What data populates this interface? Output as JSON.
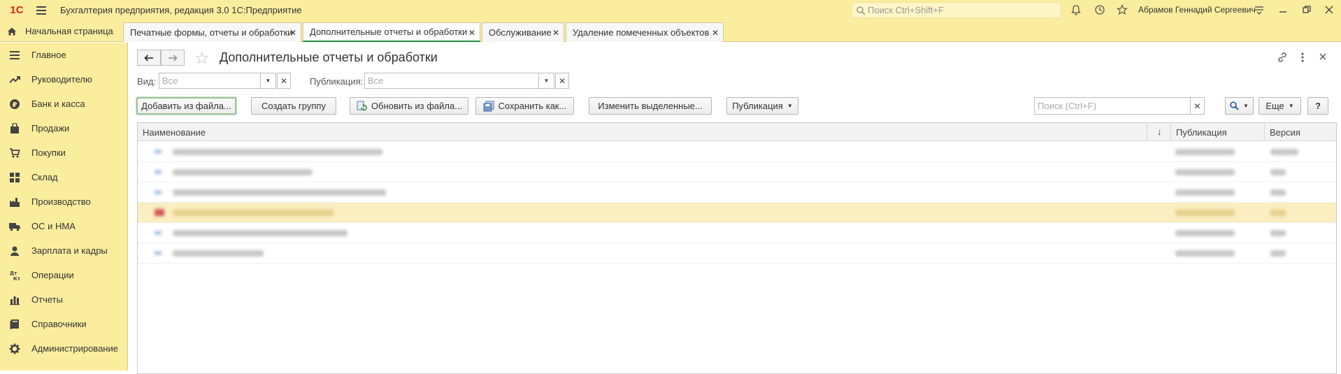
{
  "titlebar": {
    "logo_text": "1С",
    "app_title": "Бухгалтерия предприятия, редакция 3.0 1С:Предприятие",
    "search_placeholder": "Поиск Ctrl+Shift+F",
    "user_name": "Абрамов Геннадий Сергеевич",
    "accent_color": "#fbed9e"
  },
  "tabs": {
    "home_label": "Начальная страница",
    "items": [
      {
        "label": "Печатные формы, отчеты и обработки"
      },
      {
        "label": "Дополнительные отчеты и обработки",
        "active": true
      },
      {
        "label": "Обслуживание"
      },
      {
        "label": "Удаление помеченных объектов"
      }
    ]
  },
  "sidebar": {
    "items": [
      {
        "label": "Главное",
        "icon": "menu-lines-icon"
      },
      {
        "label": "Руководителю",
        "icon": "trend-icon"
      },
      {
        "label": "Банк и касса",
        "icon": "ruble-coin-icon"
      },
      {
        "label": "Продажи",
        "icon": "shopping-bag-icon"
      },
      {
        "label": "Покупки",
        "icon": "cart-icon"
      },
      {
        "label": "Склад",
        "icon": "warehouse-grid-icon"
      },
      {
        "label": "Производство",
        "icon": "factory-icon"
      },
      {
        "label": "ОС и НМА",
        "icon": "truck-icon"
      },
      {
        "label": "Зарплата и кадры",
        "icon": "person-icon"
      },
      {
        "label": "Операции",
        "icon": "dt-kt-icon"
      },
      {
        "label": "Отчеты",
        "icon": "bar-chart-icon"
      },
      {
        "label": "Справочники",
        "icon": "book-icon"
      },
      {
        "label": "Администрирование",
        "icon": "gear-icon"
      }
    ]
  },
  "form": {
    "title": "Дополнительные отчеты и обработки",
    "filters": {
      "vid_label": "Вид:",
      "vid_value": "Все",
      "publication_label": "Публикация:",
      "publication_value": "Все"
    },
    "toolbar": {
      "add_from_file": "Добавить из файла...",
      "create_group": "Создать группу",
      "update_from_file": "Обновить из файла...",
      "save_as": "Сохранить как...",
      "change_selected": "Изменить выделенные...",
      "publication": "Публикация",
      "search_placeholder": "Поиск (Ctrl+F)",
      "more": "Еще",
      "help": "?"
    },
    "table": {
      "columns": [
        "Наименование",
        "Публикация",
        "Версия"
      ],
      "row_count": 6,
      "selected_row": 4
    }
  }
}
